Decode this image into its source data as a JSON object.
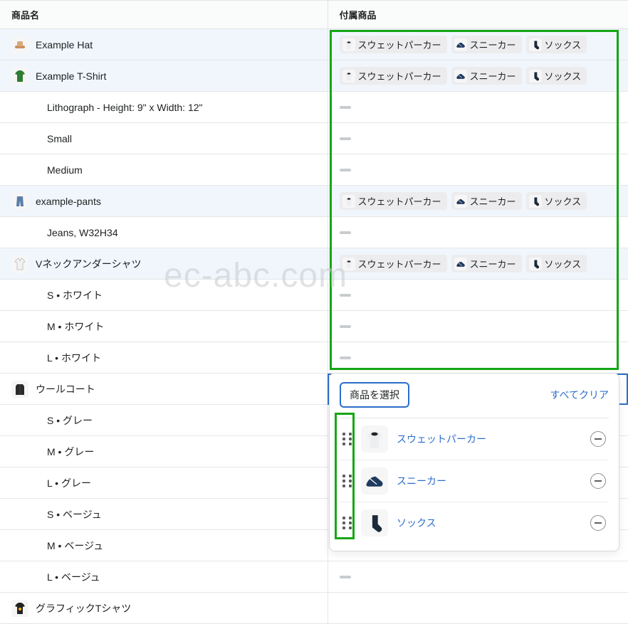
{
  "headers": {
    "name": "商品名",
    "accessory": "付属商品"
  },
  "tags": {
    "hoodie": "スウェットパーカー",
    "sneakers": "スニーカー",
    "socks": "ソックス"
  },
  "rows": [
    {
      "kind": "product",
      "name": "Example Hat",
      "icon": "hat",
      "tags": true,
      "highlight": true
    },
    {
      "kind": "product",
      "name": "Example T-Shirt",
      "icon": "tshirt",
      "tags": true,
      "highlight": true
    },
    {
      "kind": "variant",
      "name": "Lithograph - Height: 9\" x Width: 12\""
    },
    {
      "kind": "variant",
      "name": "Small"
    },
    {
      "kind": "variant",
      "name": "Medium"
    },
    {
      "kind": "product",
      "name": "example-pants",
      "icon": "pants",
      "tags": true,
      "highlight": true
    },
    {
      "kind": "variant",
      "name": "Jeans, W32H34"
    },
    {
      "kind": "product",
      "name": "Vネックアンダーシャツ",
      "icon": "vneck",
      "tags": true,
      "highlight": true
    },
    {
      "kind": "variant",
      "name": "S • ホワイト"
    },
    {
      "kind": "variant",
      "name": "M • ホワイト"
    },
    {
      "kind": "variant",
      "name": "L • ホワイト"
    },
    {
      "kind": "product",
      "name": "ウールコート",
      "icon": "coat",
      "tags": true,
      "selected": true
    },
    {
      "kind": "variant",
      "name": "S • グレー"
    },
    {
      "kind": "variant",
      "name": "M • グレー"
    },
    {
      "kind": "variant",
      "name": "L • グレー"
    },
    {
      "kind": "variant",
      "name": "S • ベージュ"
    },
    {
      "kind": "variant",
      "name": "M • ベージュ"
    },
    {
      "kind": "variant",
      "name": "L • ベージュ"
    },
    {
      "kind": "product",
      "name": "グラフィックTシャツ",
      "icon": "graphic",
      "tags": false
    }
  ],
  "selector": {
    "select_label": "商品を選択",
    "clear_label": "すべてクリア",
    "items": [
      {
        "name": "スウェットパーカー",
        "icon": "hoodie"
      },
      {
        "name": "スニーカー",
        "icon": "sneakers"
      },
      {
        "name": "ソックス",
        "icon": "socks"
      }
    ]
  },
  "watermark": "ec-abc.com"
}
